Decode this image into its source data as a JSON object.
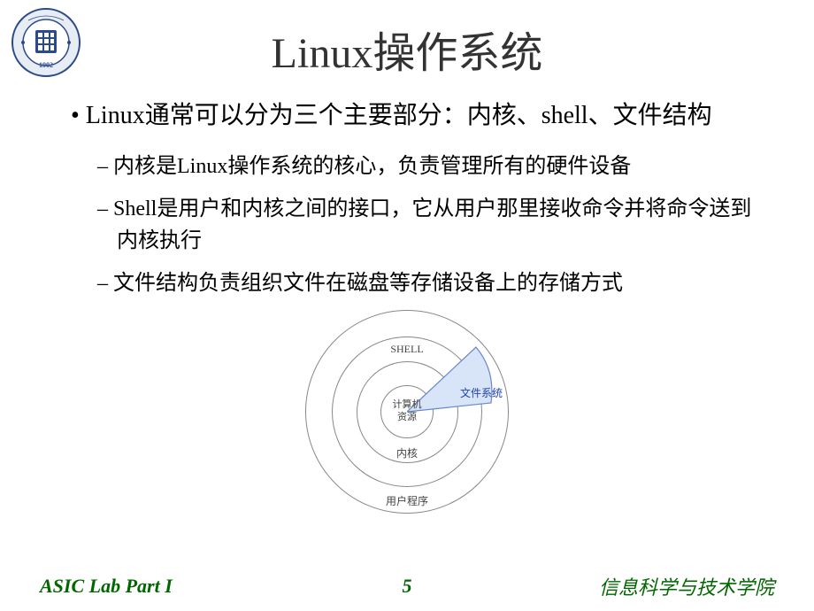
{
  "title": "Linux操作系统",
  "main_bullet": "Linux通常可以分为三个主要部分：内核、shell、文件结构",
  "sub_bullets": [
    "内核是Linux操作系统的核心，负责管理所有的硬件设备",
    "Shell是用户和内核之间的接口，它从用户那里接收命令并将命令送到内核执行",
    "文件结构负责组织文件在磁盘等存储设备上的存储方式"
  ],
  "diagram": {
    "user_programs": "用户程序",
    "shell": "SHELL",
    "kernel": "内核",
    "center_line1": "计算机",
    "center_line2": "资源",
    "filesystem": "文件系统"
  },
  "footer": {
    "left": "ASIC Lab Part I",
    "center": "5",
    "right": "信息科学与技术学院"
  },
  "logo": {
    "name": "university-seal",
    "year": "1902",
    "text_color": "#1a3a7a",
    "ring_color": "#2b4a8c"
  }
}
